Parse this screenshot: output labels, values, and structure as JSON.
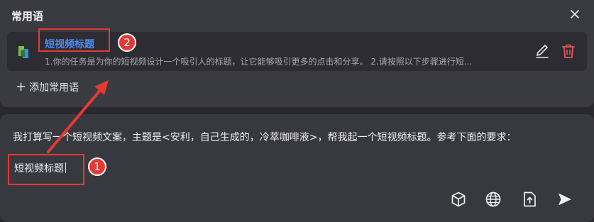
{
  "panel": {
    "title": "常用语",
    "close_icon": "close-icon",
    "phrases": [
      {
        "icon": "book-stack-icon",
        "title": "短视频标题",
        "description": "1.你的任务是为你的短视频设计一个吸引人的标题，让它能够吸引更多的点击和分享。 2.请按照以下步骤进行短...",
        "edit_icon": "edit-pencil-icon",
        "delete_icon": "trash-icon"
      }
    ],
    "add_label": "添加常用语"
  },
  "input": {
    "line1": "我打算写一个短视频文案，主题是<安利，自己生成的，冷萃咖啡液>，帮我起一个短视频标题。参考下面的要求：",
    "line2": "短视频标题"
  },
  "toolbar": {
    "buttons": [
      "cube-icon",
      "globe-icon",
      "upload-file-icon",
      "send-icon"
    ]
  },
  "annotations": {
    "badge1": "1",
    "badge2": "2",
    "color": "#e53935"
  },
  "colors": {
    "background": "#2a2a2e",
    "panel": "#3a3a41",
    "item": "#2c2c32",
    "link": "#4e8cf5",
    "delete": "#e25b5b"
  }
}
